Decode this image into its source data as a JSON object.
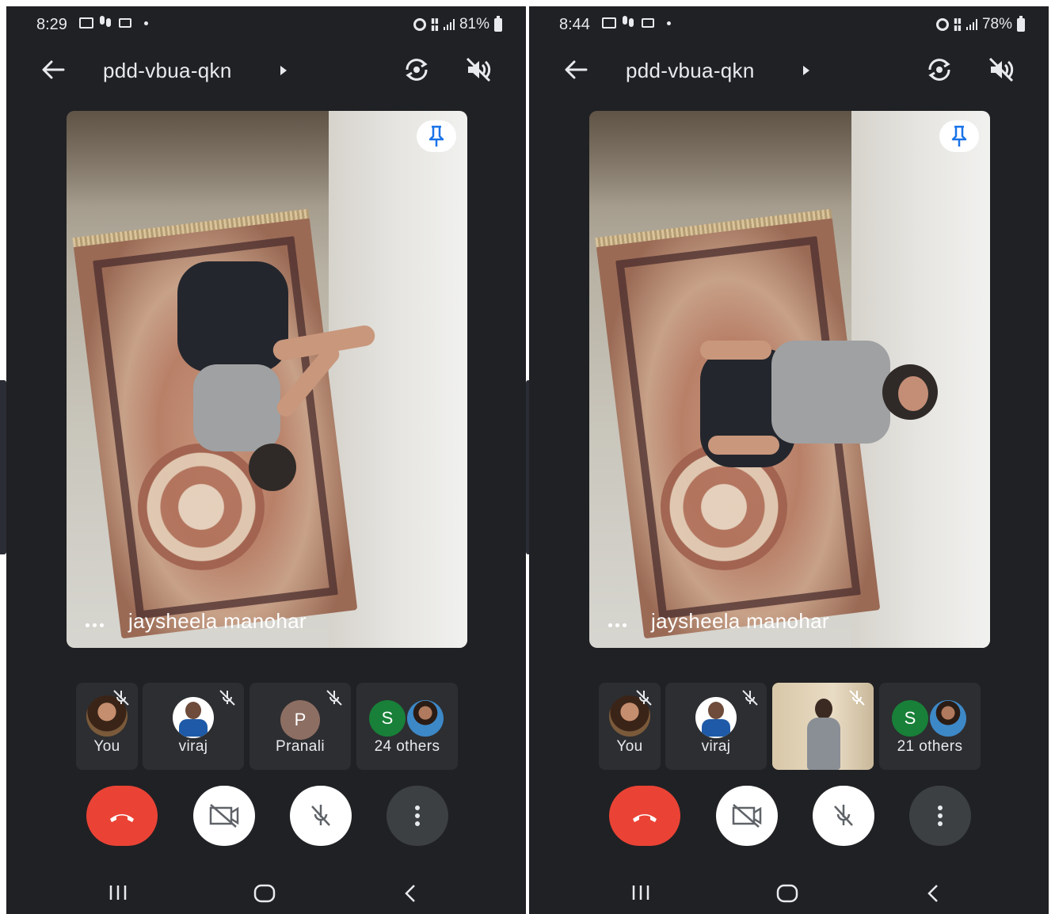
{
  "colors": {
    "background": "#202124",
    "tile": "#2d2e31",
    "end_call": "#ea4335",
    "text": "#e8eaed",
    "avatar_p": "#8d6e63",
    "avatar_s": "#188038"
  },
  "screens": [
    {
      "status": {
        "time": "8:29",
        "battery": "81%"
      },
      "meeting_code": "pdd-vbua-qkn",
      "main_tile_name": "jaysheela manohar",
      "participants": [
        {
          "label": "You",
          "avatar": "photo",
          "icon": "muted-mic-icon"
        },
        {
          "label": "viraj",
          "avatar": "photo",
          "icon": "muted-mic-icon"
        },
        {
          "label": "Pranali",
          "avatar_letter": "P",
          "icon": "muted-mic-icon"
        },
        {
          "label": "24 others",
          "avatar_letter": "S"
        }
      ]
    },
    {
      "status": {
        "time": "8:44",
        "battery": "78%"
      },
      "meeting_code": "pdd-vbua-qkn",
      "main_tile_name": "jaysheela manohar",
      "participants": [
        {
          "label": "You",
          "avatar": "photo",
          "icon": "muted-mic-icon"
        },
        {
          "label": "viraj",
          "avatar": "photo",
          "icon": "muted-mic-icon"
        },
        {
          "label": "",
          "avatar": "video-thumbnail",
          "icon": "muted-mic-icon"
        },
        {
          "label": "21 others",
          "avatar_letter": "S"
        }
      ]
    }
  ],
  "icons": {
    "header": [
      "back-arrow-icon",
      "caret-right-icon",
      "camera-flip-icon",
      "speaker-off-icon"
    ],
    "tile": [
      "more-dots-icon",
      "pin-icon"
    ],
    "controls": [
      "end-call-icon",
      "camera-off-icon",
      "mic-off-icon",
      "more-vert-icon"
    ],
    "nav": [
      "recents-icon",
      "home-icon",
      "back-icon"
    ]
  }
}
